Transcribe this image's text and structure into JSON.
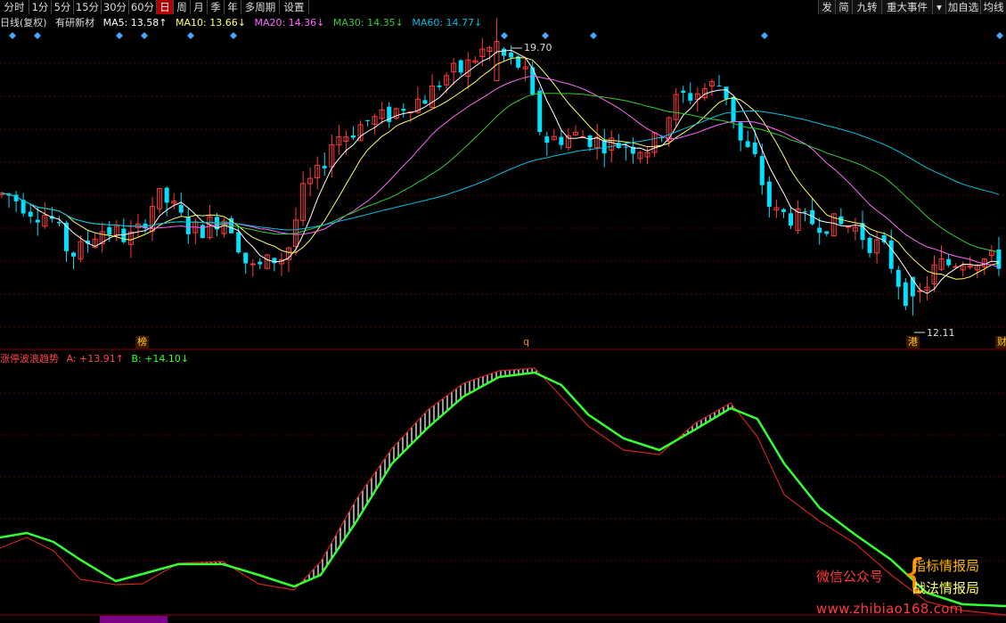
{
  "toolbar": {
    "left_items": [
      "分时",
      "1分",
      "5分",
      "15分",
      "30分",
      "60分",
      "日",
      "周",
      "月",
      "季",
      "年",
      "多周期",
      "设置"
    ],
    "active_item": "日",
    "right_items": [
      "发",
      "简",
      "九转",
      "重大事件",
      "▾",
      "加自选",
      "均线"
    ]
  },
  "info": {
    "period": "日线(复权)",
    "stock_name": "有研新材",
    "ma5": "MA5: 13.58↑",
    "ma10": "MA10: 13.66↓",
    "ma20": "MA20: 14.36↓",
    "ma30": "MA30: 14.35↓",
    "ma60": "MA60: 14.77↓"
  },
  "price_panel": {
    "high_label": "19.70",
    "low_label": "12.11",
    "markers": {
      "bang": "榜",
      "q": "q",
      "gang": "港",
      "cai": "财"
    }
  },
  "indicator": {
    "name": "涨停波浪趋势",
    "a_value": "A: +13.91↑",
    "b_value": "B: +14.10↓"
  },
  "watermark": {
    "left_text": "微信公众号",
    "brace": "{",
    "right_line1": "指标情报局",
    "right_line2": "战法情报局",
    "url": "www.zhibiao168.com"
  },
  "colors": {
    "up": "#ff3c3c",
    "down": "#00e0ff",
    "ma5": "#ffffff",
    "ma10": "#ffff66",
    "ma20": "#ff66ff",
    "ma30": "#33cc33",
    "ma60": "#00c0e0",
    "line_a": "#33ff33",
    "line_b": "#cc2222"
  }
}
